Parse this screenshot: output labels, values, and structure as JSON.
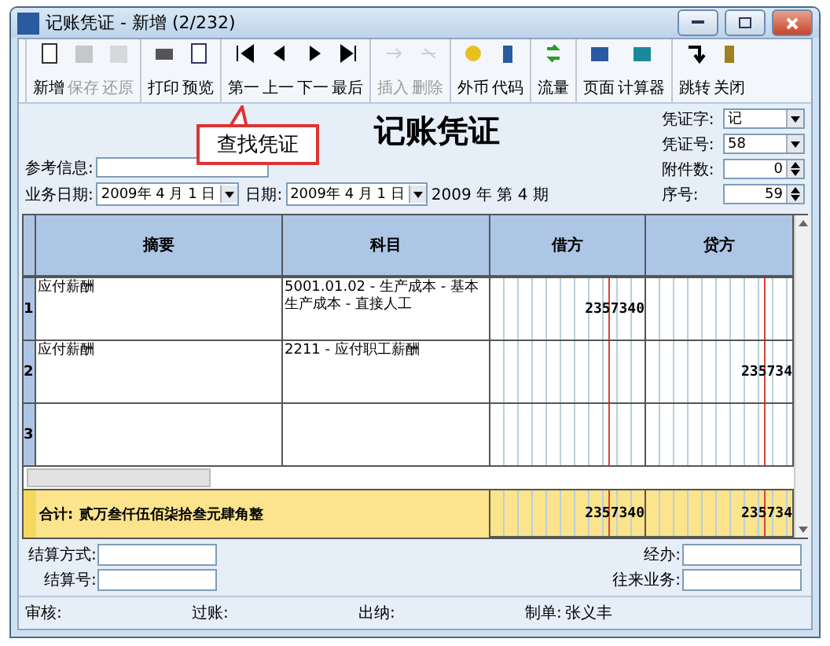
{
  "window": {
    "title": "记账凭证 - 新增 (2/232)"
  },
  "toolbar": {
    "groups": [
      [
        {
          "label": "新增",
          "disabled": false
        },
        {
          "label": "保存",
          "disabled": true
        },
        {
          "label": "还原",
          "disabled": true
        }
      ],
      [
        {
          "label": "打印",
          "disabled": false
        },
        {
          "label": "预览",
          "disabled": false
        }
      ],
      [
        {
          "label": "第一",
          "disabled": false
        },
        {
          "label": "上一",
          "disabled": false
        },
        {
          "label": "下一",
          "disabled": false
        },
        {
          "label": "最后",
          "disabled": false
        }
      ],
      [
        {
          "label": "插入",
          "disabled": true
        },
        {
          "label": "删除",
          "disabled": true
        }
      ],
      [
        {
          "label": "外币",
          "disabled": false
        },
        {
          "label": "代码",
          "disabled": false
        }
      ],
      [
        {
          "label": "流量",
          "disabled": false
        }
      ],
      [
        {
          "label": "页面",
          "disabled": false
        },
        {
          "label": "计算器",
          "disabled": false
        }
      ],
      [
        {
          "label": "跳转",
          "disabled": false
        },
        {
          "label": "关闭",
          "disabled": false
        }
      ]
    ]
  },
  "callout": {
    "text": "查找凭证"
  },
  "header": {
    "title": "记账凭证",
    "reference_label": "参考信息:",
    "business_date_label": "业务日期:",
    "business_date": "2009年 4 月 1 日",
    "date_label": "日期:",
    "date": "2009年 4 月 1 日",
    "period": "2009 年 第 4 期",
    "fields": [
      {
        "label": "凭证字:",
        "value": "记",
        "kind": "dropdown"
      },
      {
        "label": "凭证号:",
        "value": "58",
        "kind": "dropdown"
      },
      {
        "label": "附件数:",
        "value": "0",
        "kind": "spinner"
      },
      {
        "label": "序号:",
        "value": "59",
        "kind": "spinner"
      }
    ]
  },
  "table": {
    "columns": [
      "摘要",
      "科目",
      "借方",
      "贷方"
    ],
    "rows": [
      {
        "number": "1",
        "summary": "应付薪酬",
        "account": "5001.01.02 - 生产成本 - 基本生产成本 - 直接人工",
        "debit": "2357340",
        "credit": ""
      },
      {
        "number": "2",
        "summary": "应付薪酬",
        "account": "2211 - 应付职工薪酬",
        "debit": "",
        "credit": "235734"
      },
      {
        "number": "3",
        "summary": "",
        "account": "",
        "debit": "",
        "credit": ""
      }
    ],
    "total": {
      "label": "合计:",
      "amount_words": "贰万叁仟伍佰柒拾叁元肆角整",
      "debit": "2357340",
      "credit": "235734"
    }
  },
  "footer": {
    "left": [
      {
        "label": "结算方式:"
      },
      {
        "label": "结算号:"
      }
    ],
    "right": [
      {
        "label": "经办:"
      },
      {
        "label": "往来业务:"
      }
    ]
  },
  "status_bar": [
    {
      "label": "审核:"
    },
    {
      "label": "过账:"
    },
    {
      "label": "出纳:"
    },
    {
      "label": "制单:",
      "value": "张义丰"
    }
  ]
}
